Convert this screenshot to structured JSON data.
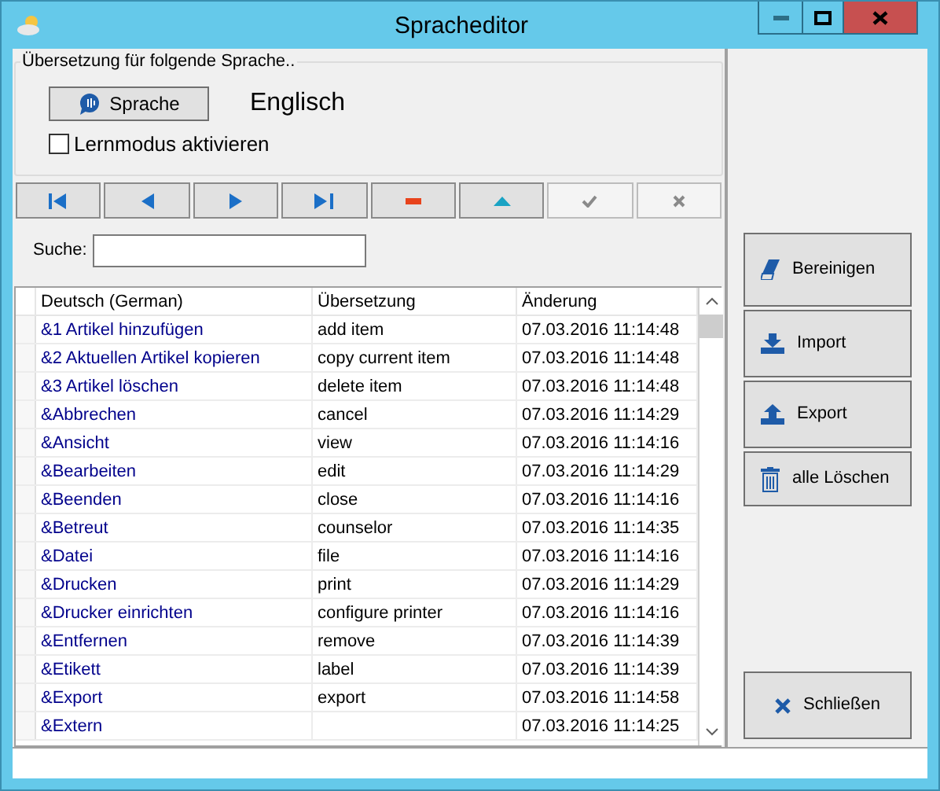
{
  "window": {
    "title": "Spracheditor"
  },
  "group": {
    "legend": "Übersetzung für folgende Sprache..",
    "language_button": "Sprache",
    "language": "Englisch",
    "learn_mode": {
      "label": "Lernmodus aktivieren",
      "checked": false
    }
  },
  "nav_buttons": [
    {
      "kind": "first",
      "disabled": false
    },
    {
      "kind": "prev",
      "disabled": false
    },
    {
      "kind": "next",
      "disabled": false
    },
    {
      "kind": "last",
      "disabled": false
    },
    {
      "kind": "delete",
      "disabled": false
    },
    {
      "kind": "up",
      "disabled": false
    },
    {
      "kind": "confirm",
      "disabled": true
    },
    {
      "kind": "cancel",
      "disabled": true
    }
  ],
  "search": {
    "label": "Suche:"
  },
  "table": {
    "columns": [
      "Deutsch (German)",
      "Übersetzung",
      "Änderung"
    ],
    "rows": [
      {
        "german": "&1 Artikel hinzufügen",
        "translation": "add item",
        "changed": "07.03.2016 11:14:48"
      },
      {
        "german": "&2 Aktuellen Artikel kopieren",
        "translation": "copy current item",
        "changed": "07.03.2016 11:14:48"
      },
      {
        "german": "&3 Artikel löschen",
        "translation": "delete item",
        "changed": "07.03.2016 11:14:48"
      },
      {
        "german": "&Abbrechen",
        "translation": "cancel",
        "changed": "07.03.2016 11:14:29"
      },
      {
        "german": "&Ansicht",
        "translation": "view",
        "changed": "07.03.2016 11:14:16"
      },
      {
        "german": "&Bearbeiten",
        "translation": "edit",
        "changed": "07.03.2016 11:14:29"
      },
      {
        "german": "&Beenden",
        "translation": "close",
        "changed": "07.03.2016 11:14:16"
      },
      {
        "german": "&Betreut",
        "translation": "counselor",
        "changed": "07.03.2016 11:14:35"
      },
      {
        "german": "&Datei",
        "translation": "file",
        "changed": "07.03.2016 11:14:16"
      },
      {
        "german": "&Drucken",
        "translation": "print",
        "changed": "07.03.2016 11:14:29"
      },
      {
        "german": "&Drucker einrichten",
        "translation": "configure printer",
        "changed": "07.03.2016 11:14:16"
      },
      {
        "german": "&Entfernen",
        "translation": "remove",
        "changed": "07.03.2016 11:14:39"
      },
      {
        "german": "&Etikett",
        "translation": "label",
        "changed": "07.03.2016 11:14:39"
      },
      {
        "german": "&Export",
        "translation": "export",
        "changed": "07.03.2016 11:14:58"
      },
      {
        "german": "&Extern",
        "translation": "",
        "changed": "07.03.2016 11:14:25"
      }
    ]
  },
  "side_buttons": [
    {
      "kind": "clean",
      "label": "Bereinigen"
    },
    {
      "kind": "import",
      "label": "Import"
    },
    {
      "kind": "export",
      "label": "Export"
    },
    {
      "kind": "delete_all",
      "label": "alle Löschen"
    }
  ],
  "close_button": {
    "label": "Schließen"
  }
}
